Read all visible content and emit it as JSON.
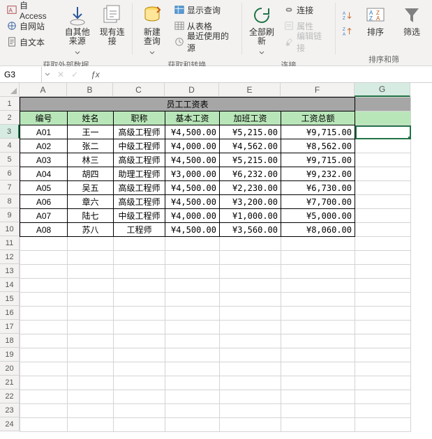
{
  "ribbon": {
    "group_ext": {
      "access": "自 Access",
      "web": "自网站",
      "text": "自文本",
      "other": "自其他来源",
      "existing": "现有连接",
      "label": "获取外部数据"
    },
    "group_query": {
      "new": "新建\n查询",
      "show": "显示查询",
      "table": "从表格",
      "recent": "最近使用的源",
      "label": "获取和转换"
    },
    "group_conn": {
      "refresh": "全部刷新",
      "conn": "连接",
      "prop": "属性",
      "edit": "编辑链接",
      "label": "连接"
    },
    "group_sort": {
      "sort": "排序",
      "filter": "筛选",
      "label": "排序和筛"
    }
  },
  "formula": {
    "cell": "G3",
    "value": ""
  },
  "sheet": {
    "title": "员工工资表",
    "headers": [
      "编号",
      "姓名",
      "职称",
      "基本工资",
      "加班工资",
      "工资总额"
    ],
    "rows": [
      {
        "id": "A01",
        "name": "王一",
        "title": "高级工程师",
        "base": "¥4,500.00",
        "ot": "¥5,215.00",
        "total": "¥9,715.00"
      },
      {
        "id": "A02",
        "name": "张二",
        "title": "中级工程师",
        "base": "¥4,000.00",
        "ot": "¥4,562.00",
        "total": "¥8,562.00"
      },
      {
        "id": "A03",
        "name": "林三",
        "title": "高级工程师",
        "base": "¥4,500.00",
        "ot": "¥5,215.00",
        "total": "¥9,715.00"
      },
      {
        "id": "A04",
        "name": "胡四",
        "title": "助理工程师",
        "base": "¥3,000.00",
        "ot": "¥6,232.00",
        "total": "¥9,232.00"
      },
      {
        "id": "A05",
        "name": "吴五",
        "title": "高级工程师",
        "base": "¥4,500.00",
        "ot": "¥2,230.00",
        "total": "¥6,730.00"
      },
      {
        "id": "A06",
        "name": "章六",
        "title": "高级工程师",
        "base": "¥4,500.00",
        "ot": "¥3,200.00",
        "total": "¥7,700.00"
      },
      {
        "id": "A07",
        "name": "陆七",
        "title": "中级工程师",
        "base": "¥4,000.00",
        "ot": "¥1,000.00",
        "total": "¥5,000.00"
      },
      {
        "id": "A08",
        "name": "苏八",
        "title": "工程师",
        "base": "¥4,500.00",
        "ot": "¥3,560.00",
        "total": "¥8,060.00"
      }
    ],
    "cols": [
      "A",
      "B",
      "C",
      "D",
      "E",
      "F",
      "G"
    ],
    "visible_row_count": 24,
    "selected_row": 3,
    "selected_col": "G"
  }
}
